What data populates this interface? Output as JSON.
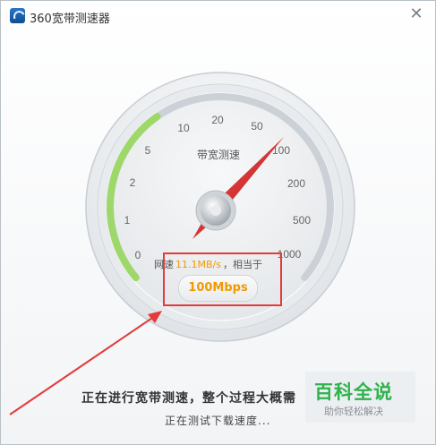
{
  "window": {
    "title": "360宽带测速器",
    "close_glyph": "✕"
  },
  "gauge": {
    "label": "带宽测速",
    "ticks": [
      "0",
      "1",
      "2",
      "5",
      "10",
      "20",
      "50",
      "100",
      "200",
      "500",
      "1000"
    ],
    "colors": {
      "progress_arc": "#9fd86a",
      "needle": "#d31f1f",
      "track": "#c9d0d6"
    }
  },
  "speed": {
    "prefix": "网速",
    "value": "11.1MB/s",
    "suffix": "，相当于",
    "bandwidth": "100Mbps",
    "value_color": "#f19a00"
  },
  "status": {
    "main": "正在进行宽带测速，整个过程大概需",
    "sub": "正在测试下载速度..."
  },
  "watermark": {
    "title": "百科全说",
    "subtitle": "助你轻松解决"
  }
}
